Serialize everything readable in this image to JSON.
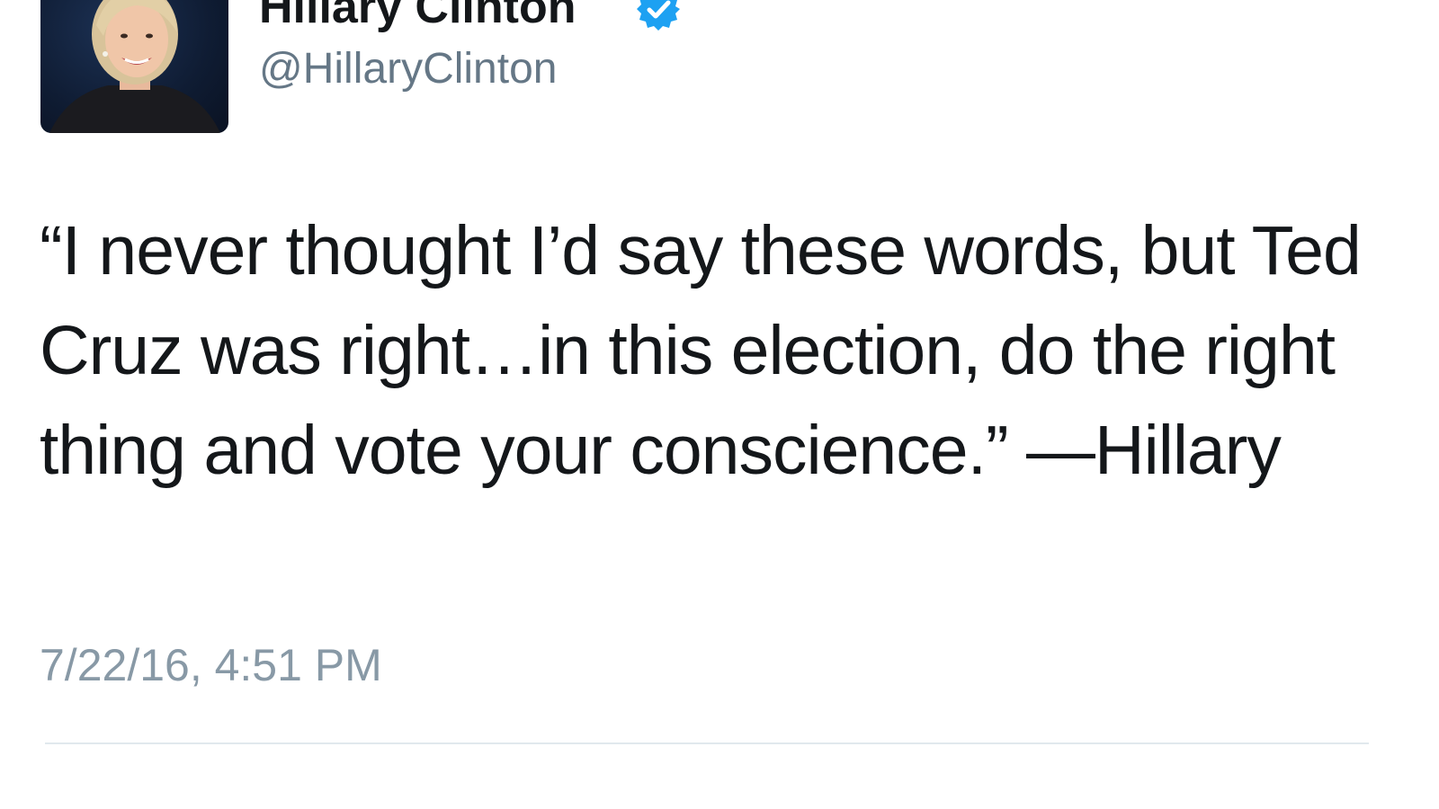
{
  "tweet": {
    "author": {
      "display_name": "Hillary Clinton",
      "handle": "@HillaryClinton",
      "verified": true,
      "avatar_icon": "profile-photo"
    },
    "text": "“I never thought I’d say these words, but Ted Cruz was right…in this election, do the right thing and vote your conscience.” —Hillary",
    "timestamp": "7/22/16, 4:51 PM"
  },
  "colors": {
    "text": "#14171a",
    "secondary_text": "#657786",
    "timestamp_text": "#8899a6",
    "verified_badge": "#1da1f2",
    "divider": "#e1e8ed"
  }
}
